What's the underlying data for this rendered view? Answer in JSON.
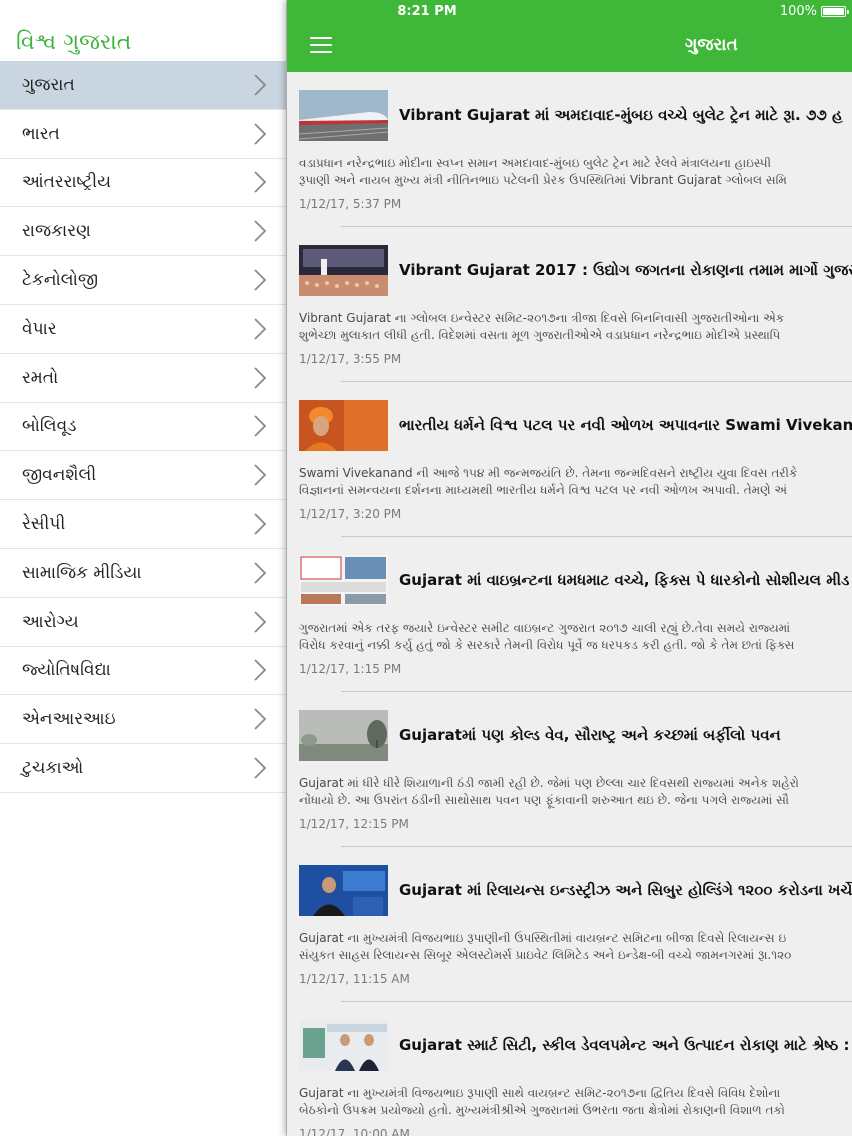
{
  "status_bar": {
    "time": "8:21 PM",
    "battery": "100%"
  },
  "sidebar": {
    "title": "વિશ્વ ગુજરાત",
    "items": [
      {
        "label": "ગુજરાત",
        "active": true
      },
      {
        "label": "ભારત"
      },
      {
        "label": "આંતરરાષ્ટ્રીય"
      },
      {
        "label": "રાજકારણ"
      },
      {
        "label": "ટેકનોલોજી"
      },
      {
        "label": "વેપાર"
      },
      {
        "label": "રમતો"
      },
      {
        "label": "બોલિવૂડ"
      },
      {
        "label": "જીવનશૈલી"
      },
      {
        "label": "રેસીપી"
      },
      {
        "label": "સામાજિક મીડિયા"
      },
      {
        "label": "આરોગ્ય"
      },
      {
        "label": "જ્યોતિષવિદ્યા"
      },
      {
        "label": "એનઆરઆઇ"
      },
      {
        "label": "ટુચકાઓ"
      }
    ]
  },
  "header": {
    "title": "ગુજરાત"
  },
  "articles": [
    {
      "title": "Vibrant Gujarat માં અમદાવાદ-મુંબઇ વચ્ચે બુલેટ ટ્રેન માટે રૂા. ૭૭ હ",
      "summary_lines": [
        "વડાપ્રધાન નરેન્દ્રભાઇ મોદીના સ્વપ્ન સમાન અમદાવાદ-મુંબઇ બુલેટ ટ્રેન માટે રેલવે મંત્રાલયના હાઇસ્પી",
        "રૂપાણી અને નાયબ મુખ્ય મંત્રી નીતિનભાઇ પટેલની પ્રેરક ઉપસ્થિતિમાં Vibrant Gujarat ગ્લોબલ સમિ"
      ],
      "date": "1/12/17, 5:37 PM",
      "thumb": "bullet-train"
    },
    {
      "title": "Vibrant Gujarat 2017 : ઉદ્યોગ જગતના રોકાણના તમામ માર્ગો ગુજરા",
      "summary_lines": [
        "Vibrant Gujarat ના ગ્લોબલ ઇન્વેસ્ટર સમિટ-૨૦૧૭ના ત્રીજા દિવસે બિનનિવાસી ગુજરાતીઓના એક",
        "શુભેચ્છા મુલાકાત લીધી હતી. વિદેશમાં વસતા મૂળ ગુજરાતીઓએ વડાપ્રધાન નરેન્દ્રભાઇ મોદીએ પ્રસ્થાપિ"
      ],
      "date": "1/12/17, 3:55 PM",
      "thumb": "stage-event"
    },
    {
      "title": "ભારતીય ધર્મને વિશ્વ પટલ પર નવી ઓળખ અપાવનાર Swami Vivekan",
      "summary_lines": [
        "Swami Vivekanand ની આજે ૧૫૪ મી જન્મજયંતિ છે. તેમના જન્મદિવસને રાષ્ટ્રીય યુવા દિવસ તરીકે",
        "વિજ્ઞાનનાં સમન્વયના દર્શનના માધ્યમથી ભારતીય ધર્મને વિશ્વ પટલ પર નવી ઓળખ અપાવી. તેમણે અં"
      ],
      "date": "1/12/17, 3:20 PM",
      "thumb": "portrait-orange"
    },
    {
      "title": "Gujarat માં વાઇબ્રન્ટના ધમધમાટ વચ્ચે, ફિક્સ પે ધારકોનો સોશીયલ મીડ",
      "summary_lines": [
        "ગુજરાતમાં એક તરફ જયારે ઇન્વેસ્ટર સમીટ વાઇબ્રન્ટ ગુજરાત ૨૦૧૭ ચાલી રહ્યું છે.તેવા સમયે રાજ્યમાં",
        "વિરોધ કરવાનું નક્કી કર્યુ હતું જો કે સરકારે તેમની વિરોધ પૂર્વે જ ધરપકડ કરી હતી. જો કે તેમ છતાં ફિક્સ"
      ],
      "date": "1/12/17, 1:15 PM",
      "thumb": "collage"
    },
    {
      "title": "Gujaratમાં પણ કોલ્ડ વેવ, સૌરાષ્ટ્ર અને કચ્છમાં બર્ફીલો પવન",
      "summary_lines": [
        "Gujarat માં ધીરે ધીરે શિયાળાની ઠંડી જામી રહી છે. જેમાં પણ છેલ્લા ચાર દિવસથી રાજ્યમાં અનેક શહેરો",
        "નોંધાયો છે. આ ઉપરાંત ઠંડીની સાથોસાથ પવન પણ ફૂંકાવાની શરુઆત થઇ છે. જેના પગલે રાજ્યમાં સૌ"
      ],
      "date": "1/12/17, 12:15 PM",
      "thumb": "fog"
    },
    {
      "title": "Gujarat માં રિલાયન્સ ઇન્ડસ્ટ્રીઝ અને સિબુર હોલ્ડિંગે ૧૨૦૦ કરોડના ખર્ચે",
      "summary_lines": [
        "Gujarat ના મુખ્યમંત્રી વિજયભાઇ રૂપાણીની ઉપસ્થિતીમાં વાયબ્રન્ટ સમિટના બીજા દિવસે રિલાયન્સ ઇ",
        "સંયુકત સાહસ રિલાયન્સ સિબૂર એલસ્ટોમર્સ પ્રાઇવેટ લિમિટેડ અને ઇન્ડેક્ષ-બી વચ્ચે જામનગરમાં રૂા.૧૨૦"
      ],
      "date": "1/12/17, 11:15 AM",
      "thumb": "speaker-blue"
    },
    {
      "title": "Gujarat સ્માર્ટ સિટી, સ્કીલ ડેવલપમેન્ટ અને ઉત્પાદન રોકાણ માટે શ્રેષ્ઠ :",
      "summary_lines": [
        "Gujarat ના મુખ્યમંત્રી વિજયભાઇ રૂપાણી સાથે વાયબ્રન્ટ સમિટ-૨૦૧૭ના દ્વિતિય દિવસે વિવિધ દેશોના",
        "બેઠકોનો ઉપક્રમ પ્રયોજ્યો હતો. મુખ્યમંત્રીશ્રીએ ગુજરાતમાં ઉભરતા જતા ક્ષેત્રોમાં રોકાણની વિશાળ તકો"
      ],
      "date": "1/12/17, 10:00 AM",
      "thumb": "handshake"
    }
  ],
  "colors": {
    "accent": "#3fb83a",
    "sidebar_title": "#3cb43c",
    "active_row": "#c9d5e0"
  }
}
